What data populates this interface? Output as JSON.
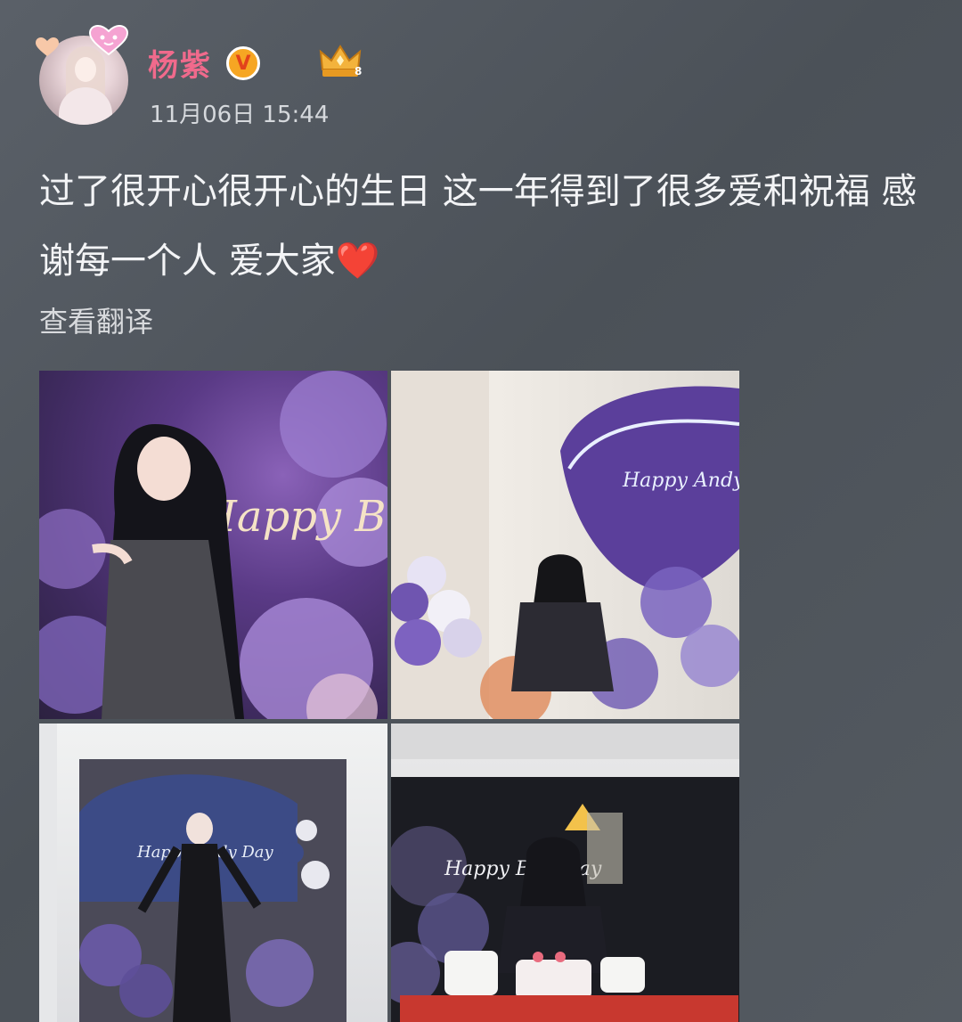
{
  "post": {
    "author": "杨紫",
    "timestamp": "11月06日 15:44",
    "text": "过了很开心很开心的生日 这一年得到了很多爱和祝福 感谢每一个人 爱大家❤️",
    "translate_label": "查看翻译"
  },
  "badges": {
    "verified_letter": "V",
    "vip_level": "8"
  },
  "images": [
    {
      "neon_text": "Happy Birthday"
    },
    {
      "neon_text": "Happy Andy Day"
    },
    {
      "neon_text": "Happy Andy Day"
    },
    {
      "neon_text": "Happy Birthday"
    }
  ],
  "colors": {
    "author_name": "#f06a8c",
    "background": "#50565d",
    "verified_badge": "#f6a623"
  },
  "icons": [
    "heart-badge-icon",
    "verified-icon",
    "vip-crown-icon"
  ]
}
